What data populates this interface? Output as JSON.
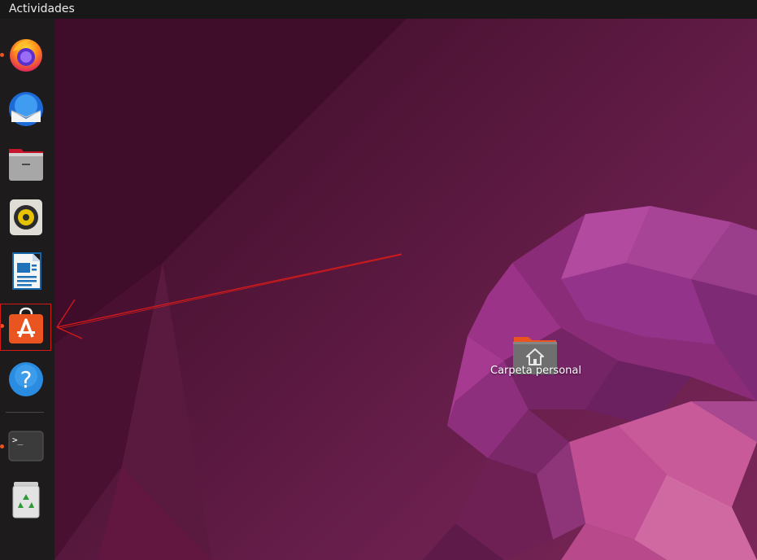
{
  "topbar": {
    "activities_label": "Actividades"
  },
  "dock": {
    "items": [
      {
        "name": "firefox",
        "icon": "firefox-icon",
        "running": true
      },
      {
        "name": "thunderbird",
        "icon": "thunderbird-icon",
        "running": false
      },
      {
        "name": "files",
        "icon": "files-icon",
        "running": false
      },
      {
        "name": "rhythmbox",
        "icon": "rhythmbox-icon",
        "running": false
      },
      {
        "name": "libreoffice-writer",
        "icon": "writer-icon",
        "running": false
      },
      {
        "name": "ubuntu-software",
        "icon": "software-store-icon",
        "running": true,
        "highlighted": true
      },
      {
        "name": "help",
        "icon": "help-icon",
        "running": false
      },
      {
        "name": "terminal",
        "icon": "terminal-icon",
        "running": true
      },
      {
        "name": "trash",
        "icon": "trash-icon",
        "running": false
      }
    ]
  },
  "desktop": {
    "home_folder": {
      "label": "Carpeta personal",
      "icon": "home-folder-icon"
    }
  },
  "help_icon_glyph": "?",
  "terminal_glyph": ">_",
  "colors": {
    "accent": "#e95420",
    "annotation": "#d61a1a",
    "topbar": "#181818",
    "dock": "#1e1b1d"
  }
}
